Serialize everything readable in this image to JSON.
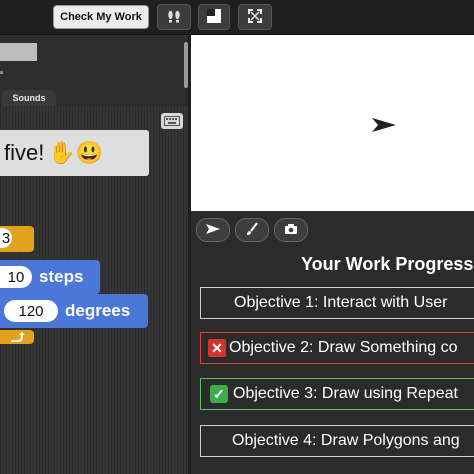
{
  "toolbar": {
    "check_label": "Check My Work",
    "footsteps_icon": "footsteps-icon",
    "layout_icon": "stage-layout-icon",
    "fullscreen_icon": "fullscreen-icon"
  },
  "palette": {
    "tab_sounds": "Sounds"
  },
  "scripts": {
    "speech_text": "five!",
    "speech_emoji": "✋😃",
    "block1_value": "3",
    "block2_value": "10",
    "block2_label": "steps",
    "block3_value": "120",
    "block3_label": "degrees"
  },
  "stage_tools": {
    "arrow_icon": "arrow-tool-icon",
    "paint_icon": "paintbrush-icon",
    "camera_icon": "camera-icon"
  },
  "progress": {
    "title": "Your Work Progress",
    "objectives": [
      {
        "label": "Objective 1: Interact with User",
        "status": "none"
      },
      {
        "label": "Objective 2: Draw Something co",
        "status": "failed"
      },
      {
        "label": "Objective 3: Draw using Repeat",
        "status": "passed"
      },
      {
        "label": "Objective 4: Draw Polygons ang",
        "status": "none"
      }
    ]
  },
  "colors": {
    "motion_block": "#4b78d8",
    "control_block": "#e3a21d",
    "failed": "#d0342c",
    "passed": "#3fae4a"
  }
}
